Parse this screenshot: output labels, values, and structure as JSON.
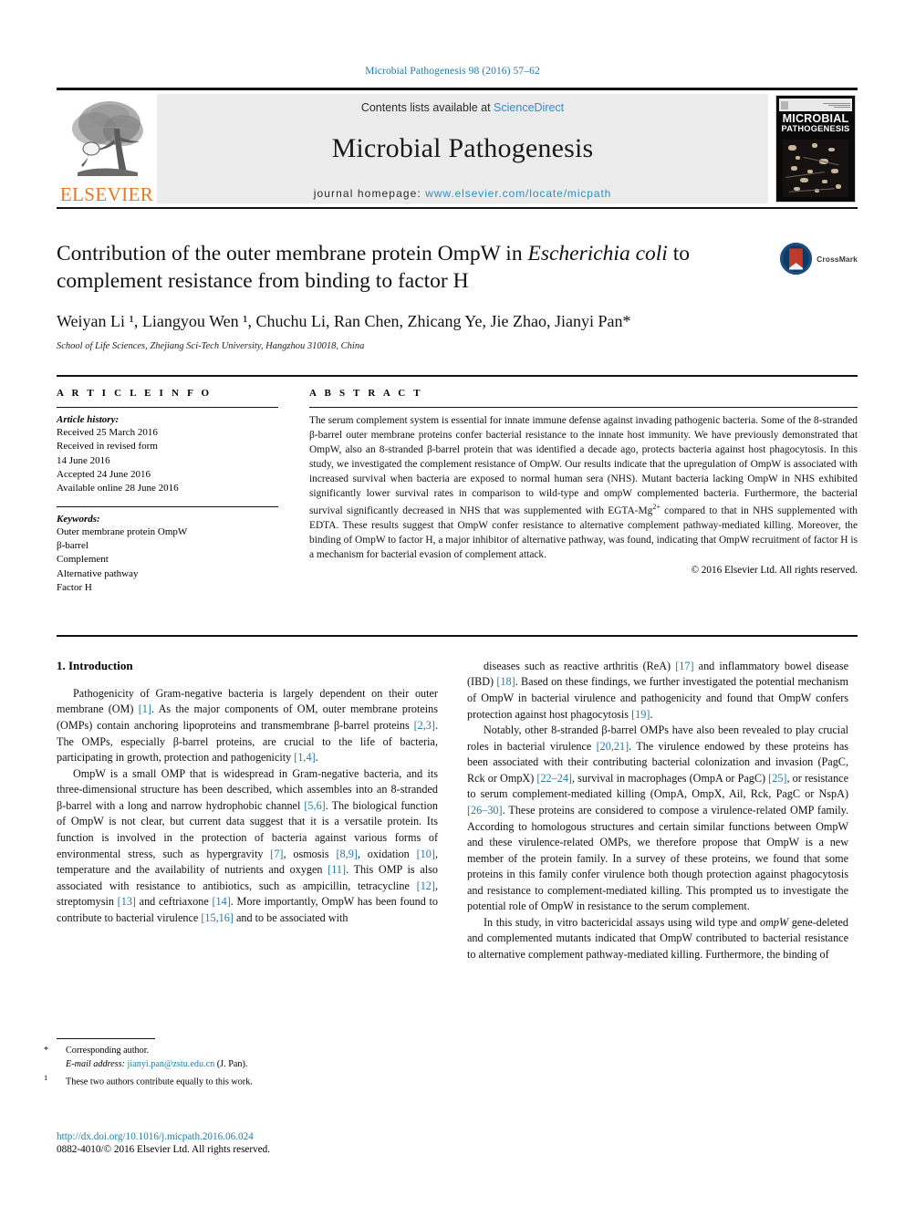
{
  "running_head": "Microbial Pathogenesis 98 (2016) 57–62",
  "masthead": {
    "contents_prefix": "Contents lists available at ",
    "sciencedirect": "ScienceDirect",
    "journal_title": "Microbial Pathogenesis",
    "homepage_prefix": "journal homepage: ",
    "homepage_url": "www.elsevier.com/locate/micpath",
    "publisher": "ELSEVIER",
    "cover_title_line1": "MICROBIAL",
    "cover_title_line2": "PATHOGENESIS"
  },
  "article": {
    "title_part1": "Contribution of the outer membrane protein OmpW in ",
    "title_italic": "Escherichia coli",
    "title_part2": " to complement resistance from binding to factor H",
    "authors": "Weiyan Li ¹, Liangyou Wen ¹, Chuchu Li, Ran Chen, Zhicang Ye, Jie Zhao, Jianyi Pan*",
    "affiliation": "School of Life Sciences, Zhejiang Sci-Tech University, Hangzhou 310018, China",
    "crossmark_label": "CrossMark"
  },
  "article_info": {
    "heading": "A R T I C L E  I N F O",
    "history_label": "Article history:",
    "history": [
      "Received 25 March 2016",
      "Received in revised form",
      "14 June 2016",
      "Accepted 24 June 2016",
      "Available online 28 June 2016"
    ],
    "keywords_label": "Keywords:",
    "keywords": [
      "Outer membrane protein OmpW",
      "β-barrel",
      "Complement",
      "Alternative pathway",
      "Factor H"
    ]
  },
  "abstract": {
    "heading": "A B S T R A C T",
    "text_before_sup": "The serum complement system is essential for innate immune defense against invading pathogenic bacteria. Some of the 8-stranded β-barrel outer membrane proteins confer bacterial resistance to the innate host immunity. We have previously demonstrated that OmpW, also an 8-stranded β-barrel protein that was identified a decade ago, protects bacteria against host phagocytosis. In this study, we investigated the complement resistance of OmpW. Our results indicate that the upregulation of OmpW is associated with increased survival when bacteria are exposed to normal human sera (NHS). Mutant bacteria lacking OmpW in NHS exhibited significantly lower survival rates in comparison to wild-type and ompW complemented bacteria. Furthermore, the bacterial survival significantly decreased in NHS that was supplemented with EGTA-Mg",
    "superscript": "2+",
    "text_after_sup": " compared to that in NHS supplemented with EDTA. These results suggest that OmpW confer resistance to alternative complement pathway-mediated killing. Moreover, the binding of OmpW to factor H, a major inhibitor of alternative pathway, was found, indicating that OmpW recruitment of factor H is a mechanism for bacterial evasion of complement attack.",
    "copyright": "© 2016 Elsevier Ltd. All rights reserved."
  },
  "introduction": {
    "heading": "1. Introduction",
    "left_paragraphs": [
      {
        "segments": [
          {
            "t": "Pathogenicity of Gram-negative bacteria is largely dependent on their outer membrane (OM) "
          },
          {
            "t": "[1]",
            "cite": true
          },
          {
            "t": ". As the major components of OM, outer membrane proteins (OMPs) contain anchoring lipoproteins and transmembrane β-barrel proteins "
          },
          {
            "t": "[2,3]",
            "cite": true
          },
          {
            "t": ". The OMPs, especially β-barrel proteins, are crucial to the life of bacteria, participating in growth, protection and pathogenicity "
          },
          {
            "t": "[1,4]",
            "cite": true
          },
          {
            "t": "."
          }
        ]
      },
      {
        "segments": [
          {
            "t": "OmpW is a small OMP that is widespread in Gram-negative bacteria, and its three-dimensional structure has been described, which assembles into an 8-stranded β-barrel with a long and narrow hydrophobic channel "
          },
          {
            "t": "[5,6]",
            "cite": true
          },
          {
            "t": ". The biological function of OmpW is not clear, but current data suggest that it is a versatile protein. Its function is involved in the protection of bacteria against various forms of environmental stress, such as hypergravity "
          },
          {
            "t": "[7]",
            "cite": true
          },
          {
            "t": ", osmosis "
          },
          {
            "t": "[8,9]",
            "cite": true
          },
          {
            "t": ", oxidation "
          },
          {
            "t": "[10]",
            "cite": true
          },
          {
            "t": ", temperature and the availability of nutrients and oxygen "
          },
          {
            "t": "[11]",
            "cite": true
          },
          {
            "t": ". This OMP is also associated with resistance to antibiotics, such as ampicillin, tetracycline "
          },
          {
            "t": "[12]",
            "cite": true
          },
          {
            "t": ", streptomysin "
          },
          {
            "t": "[13]",
            "cite": true
          },
          {
            "t": " and ceftriaxone "
          },
          {
            "t": "[14]",
            "cite": true
          },
          {
            "t": ". More importantly, OmpW has been found to contribute to bacterial virulence "
          },
          {
            "t": "[15,16]",
            "cite": true
          },
          {
            "t": " and to be associated with"
          }
        ]
      }
    ],
    "right_paragraphs": [
      {
        "segments": [
          {
            "t": "diseases such as reactive arthritis (ReA) "
          },
          {
            "t": "[17]",
            "cite": true
          },
          {
            "t": " and inflammatory bowel disease (IBD) "
          },
          {
            "t": "[18]",
            "cite": true
          },
          {
            "t": ". Based on these findings, we further investigated the potential mechanism of OmpW in bacterial virulence and pathogenicity and found that OmpW confers protection against host phagocytosis "
          },
          {
            "t": "[19]",
            "cite": true
          },
          {
            "t": "."
          }
        ],
        "no_indent": false
      },
      {
        "segments": [
          {
            "t": "Notably, other 8-stranded β-barrel OMPs have also been revealed to play crucial roles in bacterial virulence "
          },
          {
            "t": "[20,21]",
            "cite": true
          },
          {
            "t": ". The virulence endowed by these proteins has been associated with their contributing bacterial colonization and invasion (PagC, Rck or OmpX) "
          },
          {
            "t": "[22–24]",
            "cite": true
          },
          {
            "t": ", survival in macrophages (OmpA or PagC) "
          },
          {
            "t": "[25]",
            "cite": true
          },
          {
            "t": ", or resistance to serum complement-mediated killing (OmpA, OmpX, Ail, Rck, PagC or NspA) "
          },
          {
            "t": "[26–30]",
            "cite": true
          },
          {
            "t": ". These proteins are considered to compose a virulence-related OMP family. According to homologous structures and certain similar functions between OmpW and these virulence-related OMPs, we therefore propose that OmpW is a new member of the protein family. In a survey of these proteins, we found that some proteins in this family confer virulence both though protection against phagocytosis and resistance to complement-mediated killing. This prompted us to investigate the potential role of OmpW in resistance to the serum complement."
          }
        ]
      },
      {
        "segments": [
          {
            "t": "In this study, in vitro bactericidal assays using wild type and "
          },
          {
            "t": "ompW",
            "italic": true
          },
          {
            "t": " gene-deleted and complemented mutants indicated that OmpW contributed to bacterial resistance to alternative complement pathway-mediated killing. Furthermore, the binding of"
          }
        ]
      }
    ]
  },
  "footnotes": {
    "corresponding_marker": "*",
    "corresponding_text": "Corresponding author.",
    "email_label": "E-mail address:",
    "email": "jianyi.pan@zstu.edu.cn",
    "email_suffix": "(J. Pan).",
    "equal_marker": "1",
    "equal_text": "These two authors contribute equally to this work."
  },
  "publication": {
    "doi": "http://dx.doi.org/10.1016/j.micpath.2016.06.024",
    "issn_line": "0882-4010/© 2016 Elsevier Ltd. All rights reserved."
  },
  "colors": {
    "link_blue": "#1f7ba8",
    "sciencedirect_blue": "#2a8fc4",
    "elsevier_orange": "#E87722",
    "crossmark_blue": "#1a4f82",
    "crossmark_red": "#c0392b"
  }
}
